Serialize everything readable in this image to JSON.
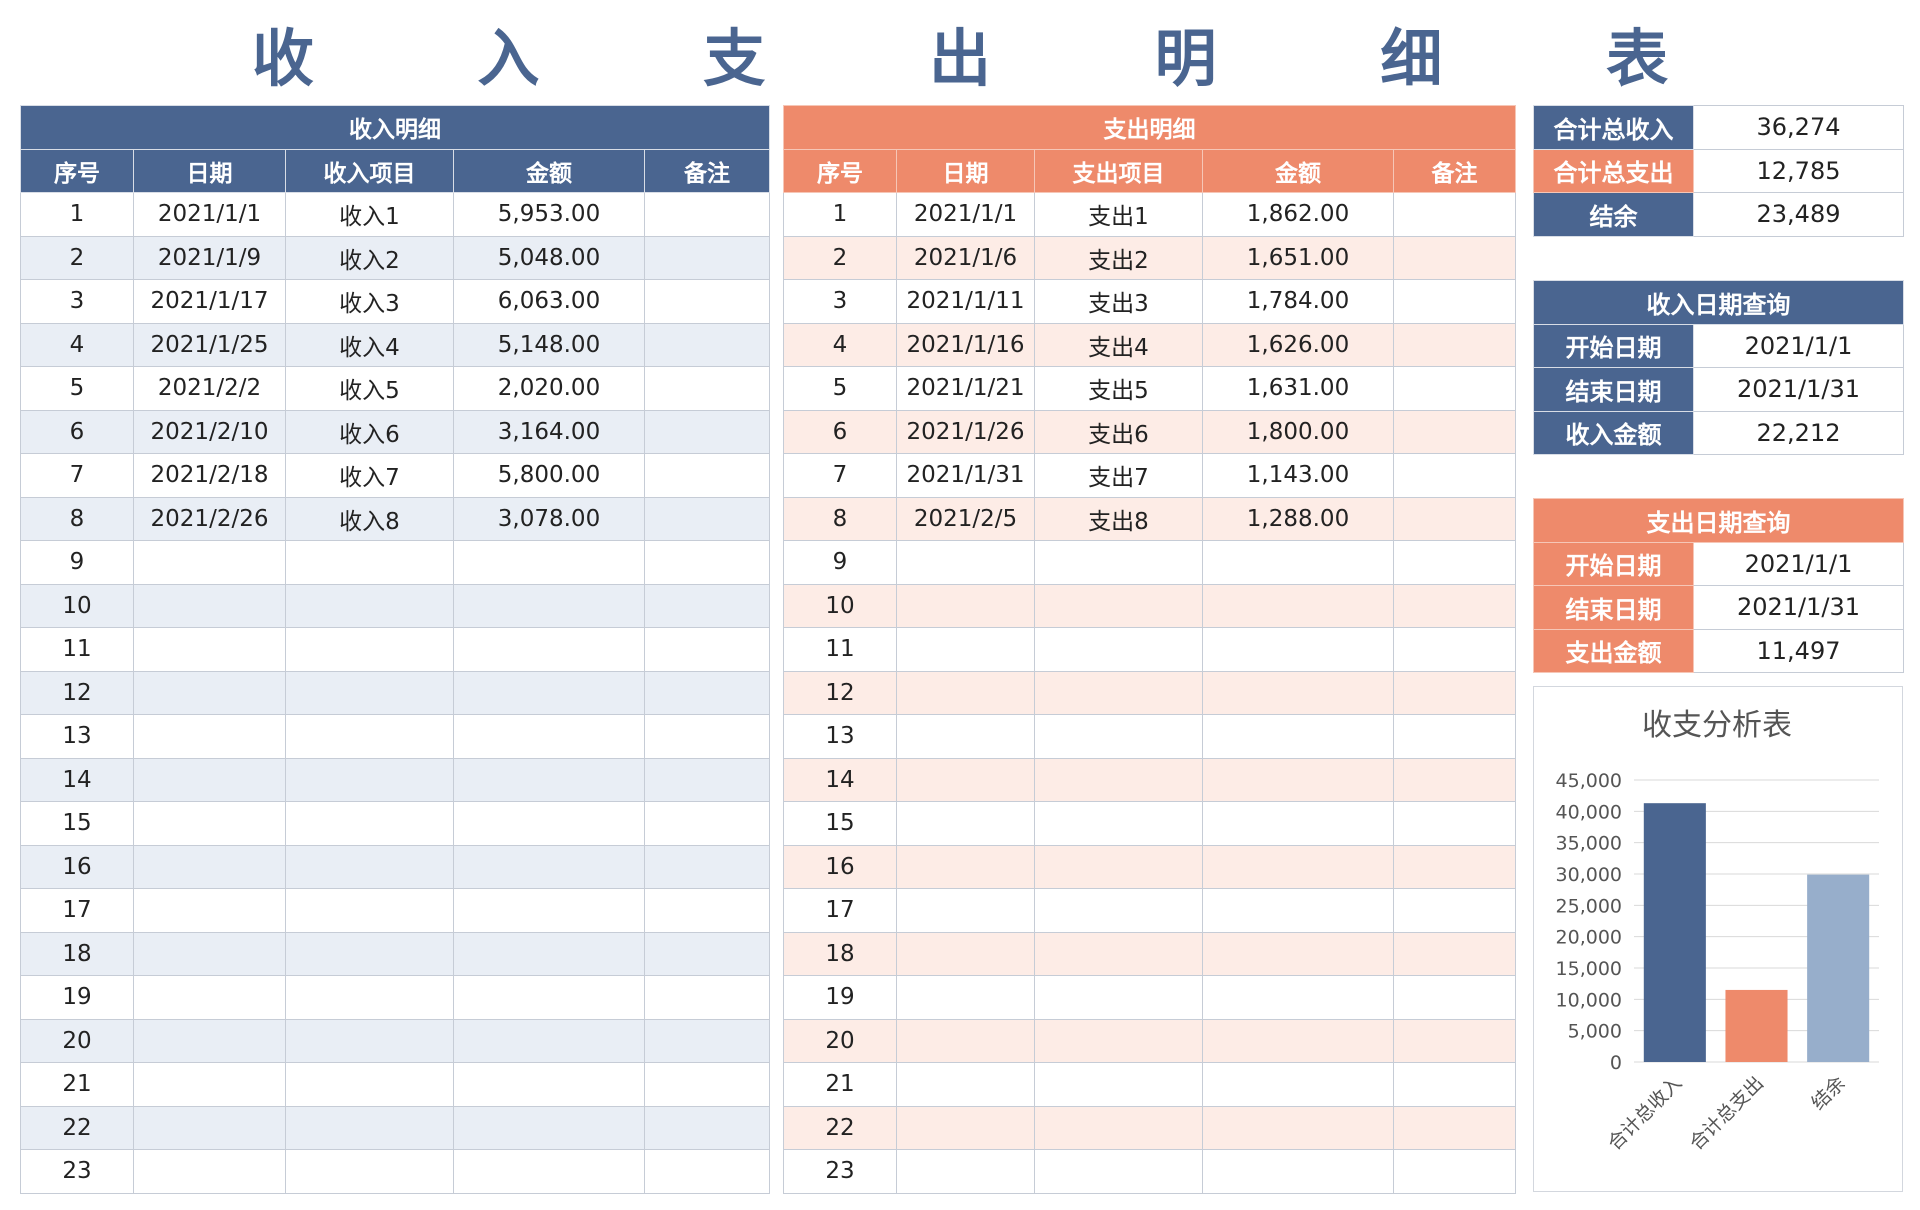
{
  "title_chars": [
    "收",
    "入",
    "支",
    "出",
    "明",
    "细",
    "表"
  ],
  "income": {
    "header": "收入明细",
    "columns": [
      "序号",
      "日期",
      "收入项目",
      "金额",
      "备注"
    ],
    "rows": [
      [
        "1",
        "2021/1/1",
        "收入1",
        "5,953.00",
        ""
      ],
      [
        "2",
        "2021/1/9",
        "收入2",
        "5,048.00",
        ""
      ],
      [
        "3",
        "2021/1/17",
        "收入3",
        "6,063.00",
        ""
      ],
      [
        "4",
        "2021/1/25",
        "收入4",
        "5,148.00",
        ""
      ],
      [
        "5",
        "2021/2/2",
        "收入5",
        "2,020.00",
        ""
      ],
      [
        "6",
        "2021/2/10",
        "收入6",
        "3,164.00",
        ""
      ],
      [
        "7",
        "2021/2/18",
        "收入7",
        "5,800.00",
        ""
      ],
      [
        "8",
        "2021/2/26",
        "收入8",
        "3,078.00",
        ""
      ],
      [
        "9",
        "",
        "",
        "",
        ""
      ],
      [
        "10",
        "",
        "",
        "",
        ""
      ],
      [
        "11",
        "",
        "",
        "",
        ""
      ],
      [
        "12",
        "",
        "",
        "",
        ""
      ],
      [
        "13",
        "",
        "",
        "",
        ""
      ],
      [
        "14",
        "",
        "",
        "",
        ""
      ],
      [
        "15",
        "",
        "",
        "",
        ""
      ],
      [
        "16",
        "",
        "",
        "",
        ""
      ],
      [
        "17",
        "",
        "",
        "",
        ""
      ],
      [
        "18",
        "",
        "",
        "",
        ""
      ],
      [
        "19",
        "",
        "",
        "",
        ""
      ],
      [
        "20",
        "",
        "",
        "",
        ""
      ],
      [
        "21",
        "",
        "",
        "",
        ""
      ],
      [
        "22",
        "",
        "",
        "",
        ""
      ],
      [
        "23",
        "",
        "",
        "",
        ""
      ]
    ]
  },
  "expense": {
    "header": "支出明细",
    "columns": [
      "序号",
      "日期",
      "支出项目",
      "金额",
      "备注"
    ],
    "rows": [
      [
        "1",
        "2021/1/1",
        "支出1",
        "1,862.00",
        ""
      ],
      [
        "2",
        "2021/1/6",
        "支出2",
        "1,651.00",
        ""
      ],
      [
        "3",
        "2021/1/11",
        "支出3",
        "1,784.00",
        ""
      ],
      [
        "4",
        "2021/1/16",
        "支出4",
        "1,626.00",
        ""
      ],
      [
        "5",
        "2021/1/21",
        "支出5",
        "1,631.00",
        ""
      ],
      [
        "6",
        "2021/1/26",
        "支出6",
        "1,800.00",
        ""
      ],
      [
        "7",
        "2021/1/31",
        "支出7",
        "1,143.00",
        ""
      ],
      [
        "8",
        "2021/2/5",
        "支出8",
        "1,288.00",
        ""
      ],
      [
        "9",
        "",
        "",
        "",
        ""
      ],
      [
        "10",
        "",
        "",
        "",
        ""
      ],
      [
        "11",
        "",
        "",
        "",
        ""
      ],
      [
        "12",
        "",
        "",
        "",
        ""
      ],
      [
        "13",
        "",
        "",
        "",
        ""
      ],
      [
        "14",
        "",
        "",
        "",
        ""
      ],
      [
        "15",
        "",
        "",
        "",
        ""
      ],
      [
        "16",
        "",
        "",
        "",
        ""
      ],
      [
        "17",
        "",
        "",
        "",
        ""
      ],
      [
        "18",
        "",
        "",
        "",
        ""
      ],
      [
        "19",
        "",
        "",
        "",
        ""
      ],
      [
        "20",
        "",
        "",
        "",
        ""
      ],
      [
        "21",
        "",
        "",
        "",
        ""
      ],
      [
        "22",
        "",
        "",
        "",
        ""
      ],
      [
        "23",
        "",
        "",
        "",
        ""
      ]
    ]
  },
  "summary": [
    {
      "label": "合计总收入",
      "value": "36,274",
      "tone": "blue"
    },
    {
      "label": "合计总支出",
      "value": "12,785",
      "tone": "orange"
    },
    {
      "label": "结余",
      "value": "23,489",
      "tone": "blue"
    }
  ],
  "income_query": {
    "header": "收入日期查询",
    "rows": [
      {
        "label": "开始日期",
        "value": "2021/1/1"
      },
      {
        "label": "结束日期",
        "value": "2021/1/31"
      },
      {
        "label": "收入金额",
        "value": "22,212"
      }
    ]
  },
  "expense_query": {
    "header": "支出日期查询",
    "rows": [
      {
        "label": "开始日期",
        "value": "2021/1/1"
      },
      {
        "label": "结束日期",
        "value": "2021/1/31"
      },
      {
        "label": "支出金额",
        "value": "11,497"
      }
    ]
  },
  "colors": {
    "blue": "#4a6590",
    "orange": "#ee8a6b",
    "light_blue": "#97aecb",
    "blue_stripe": "#e9eef5",
    "orange_stripe": "#fdece6"
  },
  "chart_data": {
    "type": "bar",
    "title": "收支分析表",
    "categories": [
      "合计总收入",
      "合计总支出",
      "结余"
    ],
    "values": [
      41300,
      11500,
      29900
    ],
    "bar_colors": [
      "#4a6590",
      "#ee8a6b",
      "#97aecb"
    ],
    "yticks": [
      "0",
      "5,000",
      "10,000",
      "15,000",
      "20,000",
      "25,000",
      "30,000",
      "35,000",
      "40,000",
      "45,000"
    ],
    "ylim": [
      0,
      45000
    ],
    "grid": true,
    "legend": "none"
  }
}
